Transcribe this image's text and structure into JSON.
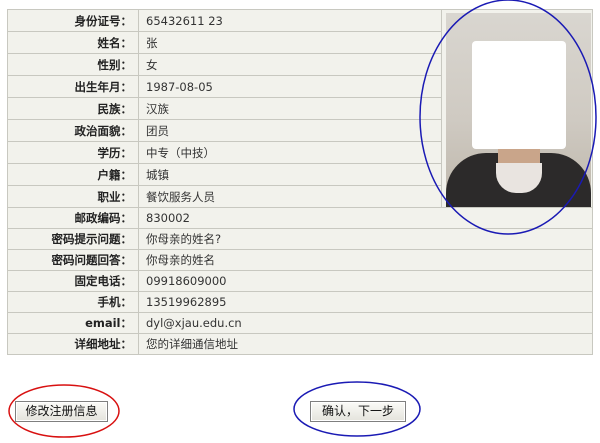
{
  "rows": [
    {
      "label": "身份证号：",
      "value": "65432611          23"
    },
    {
      "label": "姓名：",
      "value": "张"
    },
    {
      "label": "性别：",
      "value": "女"
    },
    {
      "label": "出生年月：",
      "value": "1987-08-05"
    },
    {
      "label": "民族：",
      "value": "汉族"
    },
    {
      "label": "政治面貌：",
      "value": "团员"
    },
    {
      "label": "学历：",
      "value": "中专（中技）"
    },
    {
      "label": "户籍：",
      "value": "城镇"
    },
    {
      "label": "职业：",
      "value": "餐饮服务人员"
    },
    {
      "label": "邮政编码：",
      "value": "830002"
    },
    {
      "label": "密码提示问题：",
      "value": "你母亲的姓名?"
    },
    {
      "label": "密码问题回答：",
      "value": "你母亲的姓名"
    },
    {
      "label": "固定电话：",
      "value": "09918609000"
    },
    {
      "label": "手机：",
      "value": "13519962895"
    },
    {
      "label": "email：",
      "value": "dyl@xjau.edu.cn"
    },
    {
      "label": "详细地址：",
      "value": "您的详细通信地址"
    }
  ],
  "buttons": {
    "modify": "修改注册信息",
    "confirm": "确认，下一步"
  },
  "annotation_colors": {
    "photo_circle": "#1a1ab4",
    "modify_circle": "#d81010",
    "confirm_circle": "#1a1ab4"
  }
}
